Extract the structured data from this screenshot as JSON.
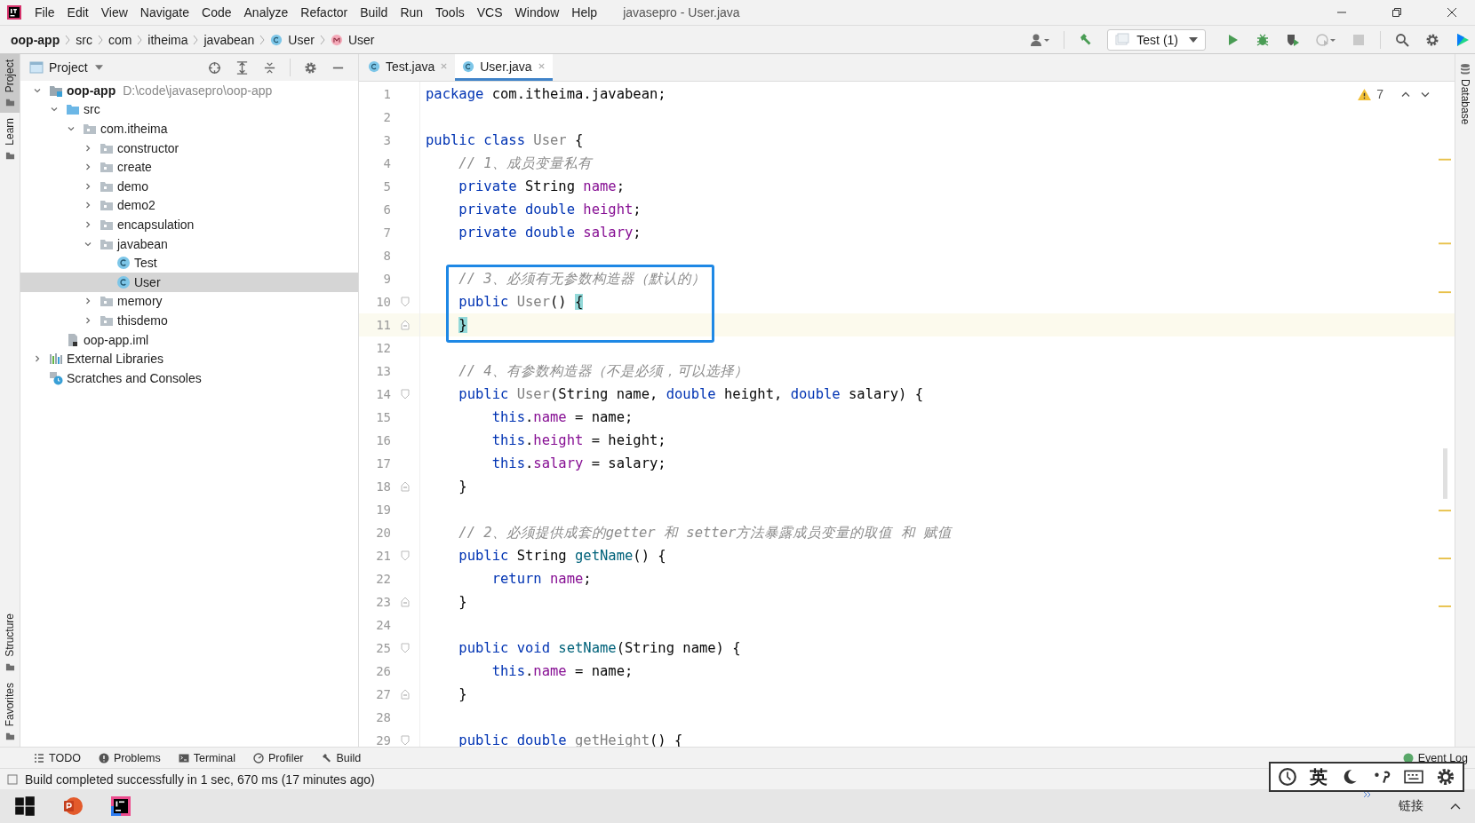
{
  "window": {
    "title": "javasepro - User.java"
  },
  "menu": [
    "File",
    "Edit",
    "View",
    "Navigate",
    "Code",
    "Analyze",
    "Refactor",
    "Build",
    "Run",
    "Tools",
    "VCS",
    "Window",
    "Help"
  ],
  "breadcrumb": [
    {
      "label": "oop-app",
      "kind": "module"
    },
    {
      "label": "src",
      "kind": "folder"
    },
    {
      "label": "com",
      "kind": "folder"
    },
    {
      "label": "itheima",
      "kind": "folder"
    },
    {
      "label": "javabean",
      "kind": "folder"
    },
    {
      "label": "User",
      "kind": "class"
    },
    {
      "label": "User",
      "kind": "method"
    }
  ],
  "run_config": "Test (1)",
  "left_strip": [
    {
      "label": "Project",
      "selected": true
    },
    {
      "label": "Learn",
      "selected": false
    },
    {
      "label": "Structure",
      "selected": false
    },
    {
      "label": "Favorites",
      "selected": false
    }
  ],
  "right_strip": [
    {
      "label": "Database"
    }
  ],
  "project_panel": {
    "title": "Project",
    "tree": [
      {
        "label": "oop-app",
        "kind": "module",
        "hint": "D:\\code\\javasepro\\oop-app",
        "expanded": true,
        "selected": false,
        "children": [
          {
            "label": "src",
            "kind": "source",
            "expanded": true,
            "selected": false,
            "children": [
              {
                "label": "com.itheima",
                "kind": "package",
                "expanded": true,
                "selected": false,
                "children": [
                  {
                    "label": "constructor",
                    "kind": "package",
                    "expanded": false,
                    "selected": false
                  },
                  {
                    "label": "create",
                    "kind": "package",
                    "expanded": false,
                    "selected": false
                  },
                  {
                    "label": "demo",
                    "kind": "package",
                    "expanded": false,
                    "selected": false
                  },
                  {
                    "label": "demo2",
                    "kind": "package",
                    "expanded": false,
                    "selected": false
                  },
                  {
                    "label": "encapsulation",
                    "kind": "package",
                    "expanded": false,
                    "selected": false
                  },
                  {
                    "label": "javabean",
                    "kind": "package",
                    "expanded": true,
                    "selected": false,
                    "children": [
                      {
                        "label": "Test",
                        "kind": "class",
                        "selected": false
                      },
                      {
                        "label": "User",
                        "kind": "class",
                        "selected": true
                      }
                    ]
                  },
                  {
                    "label": "memory",
                    "kind": "package",
                    "expanded": false,
                    "selected": false
                  },
                  {
                    "label": "thisdemo",
                    "kind": "package",
                    "expanded": false,
                    "selected": false
                  }
                ]
              }
            ]
          },
          {
            "label": "oop-app.iml",
            "kind": "file",
            "selected": false
          }
        ]
      },
      {
        "label": "External Libraries",
        "kind": "libraries",
        "expanded": false,
        "selected": false
      },
      {
        "label": "Scratches and Consoles",
        "kind": "scratches",
        "selected": false
      }
    ]
  },
  "editor_tabs": [
    {
      "label": "Test.java",
      "selected": false
    },
    {
      "label": "User.java",
      "selected": true
    }
  ],
  "warnings": "7",
  "code_lines": [
    {
      "no": "1",
      "tokens": [
        {
          "kind": "kw",
          "text": "package"
        },
        {
          "kind": "plain",
          "text": " com.itheima.javabean;"
        }
      ]
    },
    {
      "no": "2"
    },
    {
      "no": "3",
      "tokens": [
        {
          "kind": "kw",
          "text": "public class "
        },
        {
          "kind": "unused",
          "text": "User"
        },
        {
          "kind": "plain",
          "text": " {"
        }
      ]
    },
    {
      "no": "4",
      "tokens": [
        {
          "kind": "comment",
          "text": "    // 1、成员变量私有"
        }
      ]
    },
    {
      "no": "5",
      "tokens": [
        {
          "kind": "kw",
          "text": "    private"
        },
        {
          "kind": "plain",
          "text": " String "
        },
        {
          "kind": "field",
          "text": "name"
        },
        {
          "kind": "plain",
          "text": ";"
        }
      ]
    },
    {
      "no": "6",
      "tokens": [
        {
          "kind": "kw",
          "text": "    private double "
        },
        {
          "kind": "field",
          "text": "height"
        },
        {
          "kind": "plain",
          "text": ";"
        }
      ]
    },
    {
      "no": "7",
      "tokens": [
        {
          "kind": "kw",
          "text": "    private double "
        },
        {
          "kind": "field",
          "text": "salary"
        },
        {
          "kind": "plain",
          "text": ";"
        }
      ]
    },
    {
      "no": "8"
    },
    {
      "no": "9",
      "boxed": true,
      "tokens": [
        {
          "kind": "comment",
          "text": "    // 3、必须有无参数构造器（默认的）"
        }
      ]
    },
    {
      "no": "10",
      "boxed": true,
      "fold_start": true,
      "tokens": [
        {
          "kind": "kw",
          "text": "    public "
        },
        {
          "kind": "unused",
          "text": "User"
        },
        {
          "kind": "plain",
          "text": "() "
        },
        {
          "kind": "brace",
          "text": "{"
        }
      ]
    },
    {
      "no": "11",
      "boxed": true,
      "current": true,
      "fold_end": true,
      "tokens": [
        {
          "kind": "brace",
          "text": "    }"
        }
      ]
    },
    {
      "no": "12"
    },
    {
      "no": "13",
      "tokens": [
        {
          "kind": "comment",
          "text": "    // 4、有参数构造器（不是必须，可以选择）"
        }
      ]
    },
    {
      "no": "14",
      "fold_start": true,
      "tokens": [
        {
          "kind": "kw",
          "text": "    public "
        },
        {
          "kind": "unused",
          "text": "User"
        },
        {
          "kind": "plain",
          "text": "(String name, "
        },
        {
          "kind": "kw",
          "text": "double"
        },
        {
          "kind": "plain",
          "text": " height, "
        },
        {
          "kind": "kw",
          "text": "double"
        },
        {
          "kind": "plain",
          "text": " salary) {"
        }
      ]
    },
    {
      "no": "15",
      "tokens": [
        {
          "kind": "kw",
          "text": "        this"
        },
        {
          "kind": "plain",
          "text": "."
        },
        {
          "kind": "field",
          "text": "name"
        },
        {
          "kind": "plain",
          "text": " = name;"
        }
      ]
    },
    {
      "no": "16",
      "tokens": [
        {
          "kind": "kw",
          "text": "        this"
        },
        {
          "kind": "plain",
          "text": "."
        },
        {
          "kind": "field",
          "text": "height"
        },
        {
          "kind": "plain",
          "text": " = height;"
        }
      ]
    },
    {
      "no": "17",
      "tokens": [
        {
          "kind": "kw",
          "text": "        this"
        },
        {
          "kind": "plain",
          "text": "."
        },
        {
          "kind": "field",
          "text": "salary"
        },
        {
          "kind": "plain",
          "text": " = salary;"
        }
      ]
    },
    {
      "no": "18",
      "fold_end": true,
      "tokens": [
        {
          "kind": "plain",
          "text": "    }"
        }
      ]
    },
    {
      "no": "19"
    },
    {
      "no": "20",
      "tokens": [
        {
          "kind": "comment",
          "text": "    // 2、必须提供成套的getter 和 setter方法暴露成员变量的取值 和 赋值"
        }
      ]
    },
    {
      "no": "21",
      "fold_start": true,
      "tokens": [
        {
          "kind": "kw",
          "text": "    public"
        },
        {
          "kind": "plain",
          "text": " String "
        },
        {
          "kind": "method",
          "text": "getName"
        },
        {
          "kind": "plain",
          "text": "() {"
        }
      ]
    },
    {
      "no": "22",
      "tokens": [
        {
          "kind": "kw",
          "text": "        return "
        },
        {
          "kind": "field",
          "text": "name"
        },
        {
          "kind": "plain",
          "text": ";"
        }
      ]
    },
    {
      "no": "23",
      "fold_end": true,
      "tokens": [
        {
          "kind": "plain",
          "text": "    }"
        }
      ]
    },
    {
      "no": "24"
    },
    {
      "no": "25",
      "fold_start": true,
      "tokens": [
        {
          "kind": "kw",
          "text": "    public void "
        },
        {
          "kind": "method",
          "text": "setName"
        },
        {
          "kind": "plain",
          "text": "(String name) {"
        }
      ]
    },
    {
      "no": "26",
      "tokens": [
        {
          "kind": "kw",
          "text": "        this"
        },
        {
          "kind": "plain",
          "text": "."
        },
        {
          "kind": "field",
          "text": "name"
        },
        {
          "kind": "plain",
          "text": " = name;"
        }
      ]
    },
    {
      "no": "27",
      "fold_end": true,
      "tokens": [
        {
          "kind": "plain",
          "text": "    }"
        }
      ]
    },
    {
      "no": "28"
    },
    {
      "no": "29",
      "fold_start": true,
      "tokens": [
        {
          "kind": "kw",
          "text": "    public double "
        },
        {
          "kind": "unused",
          "text": "getHeight"
        },
        {
          "kind": "plain",
          "text": "() {"
        }
      ]
    }
  ],
  "tool_tabs": [
    {
      "label": "TODO",
      "kind": "todo"
    },
    {
      "label": "Problems",
      "kind": "problems"
    },
    {
      "label": "Terminal",
      "kind": "terminal"
    },
    {
      "label": "Profiler",
      "kind": "profiler"
    },
    {
      "label": "Build",
      "kind": "build"
    }
  ],
  "event_log": "Event Log",
  "status": "Build completed successfully in 1 sec, 670 ms (17 minutes ago)",
  "ime_mode": "英",
  "taskbar": {
    "tray_text": "链接"
  }
}
